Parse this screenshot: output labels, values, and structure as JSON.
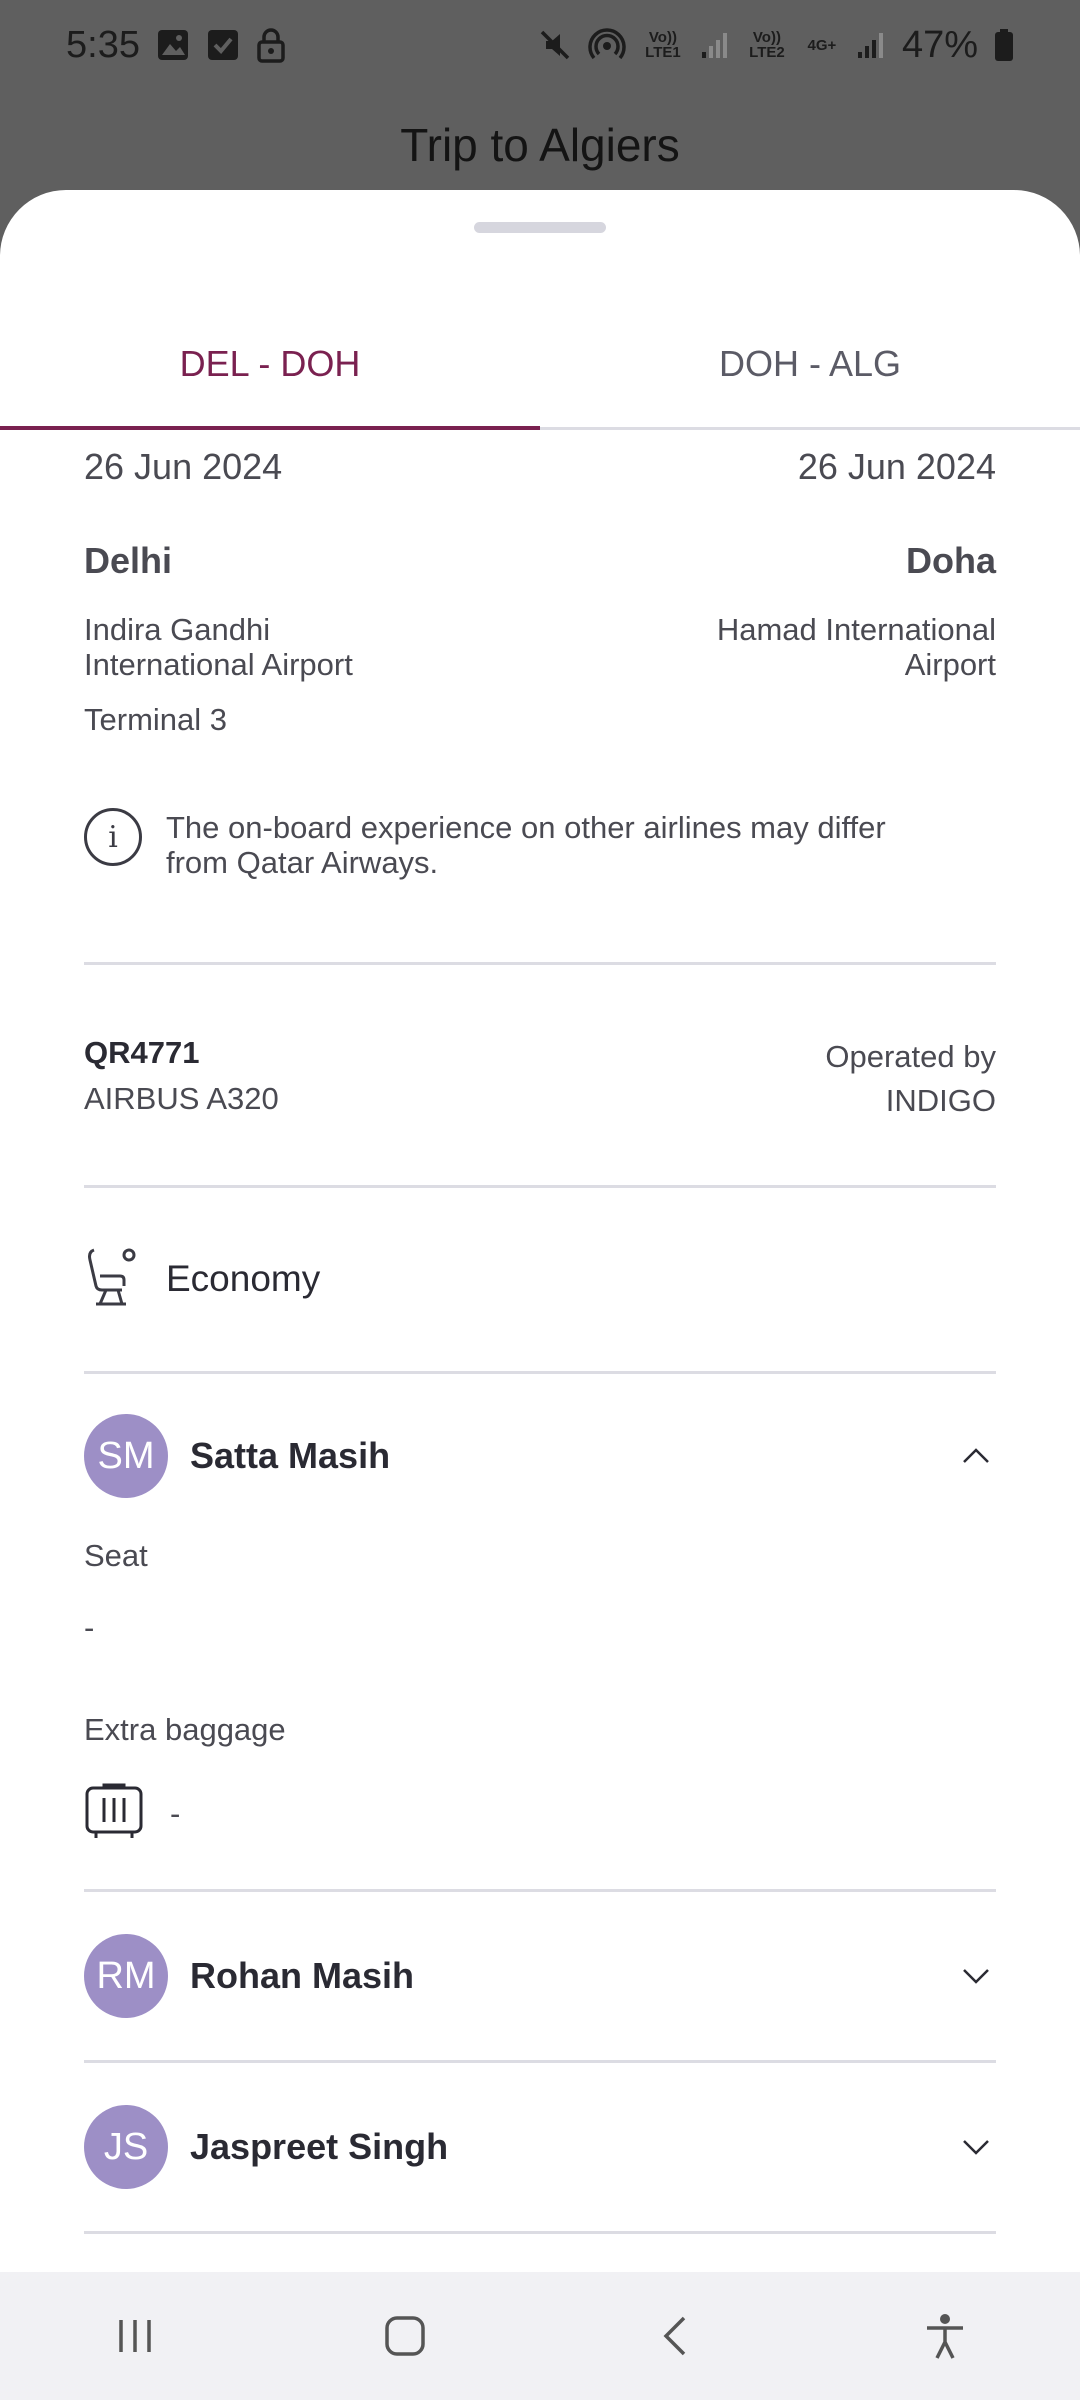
{
  "status_bar": {
    "time": "5:35",
    "left_icons": [
      "image-icon",
      "checkbox-icon",
      "lock-icon"
    ],
    "right_icons": [
      "mute-icon",
      "hotspot-icon",
      "volte1-icon",
      "signal1-icon",
      "volte2-icon",
      "4g-icon",
      "signal2-icon"
    ],
    "volte1": "Vo)) LTE1",
    "volte2": "Vo)) LTE2",
    "net": "4G+",
    "battery": "47%"
  },
  "page": {
    "title": "Trip to Algiers"
  },
  "tabs": [
    {
      "label": "DEL - DOH",
      "active": true
    },
    {
      "label": "DOH - ALG",
      "active": false
    }
  ],
  "segment": {
    "departure": {
      "date": "26 Jun 2024",
      "city": "Delhi",
      "airport_line1": "Indira Gandhi",
      "airport_line2": "International Airport",
      "terminal": "Terminal 3"
    },
    "arrival": {
      "date": "26 Jun 2024",
      "city": "Doha",
      "airport_line1": "Hamad International",
      "airport_line2": "Airport"
    },
    "notice_line1": "The on-board experience on other airlines may differ",
    "notice_line2": "from Qatar Airways.",
    "flight_number": "QR4771",
    "aircraft": "AIRBUS A320",
    "operated_by_label": "Operated by",
    "operator": "INDIGO",
    "cabin": "Economy"
  },
  "passengers": [
    {
      "initials": "SM",
      "name": "Satta Masih",
      "expanded": true,
      "seat_label": "Seat",
      "seat_value": "-",
      "baggage_label": "Extra baggage",
      "baggage_value": "-"
    },
    {
      "initials": "RM",
      "name": "Rohan Masih",
      "expanded": false
    },
    {
      "initials": "JS",
      "name": "Jaspreet Singh",
      "expanded": false
    }
  ],
  "colors": {
    "accent": "#7a2150",
    "avatar": "#9d8fc6",
    "divider": "#dcdce3",
    "scrim": "#5f5f5f"
  }
}
